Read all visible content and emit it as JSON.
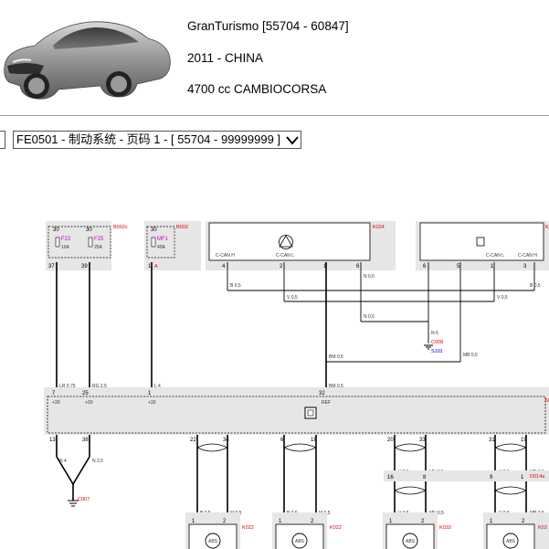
{
  "vehicle": {
    "model_line": "GranTurismo [55704 - 60847]",
    "year_market": "2011 - CHINA",
    "engine_gearbox": "4700 cc CAMBIOCORSA"
  },
  "selector": {
    "value": "FE0501 - 制动系统 - 页码 1 - [ 55704 - 99999999 ]"
  },
  "diagram": {
    "components": {
      "fusebox": "B002c",
      "fusebox2": "B003",
      "module_k024": "K024",
      "module_right": "K",
      "main_unit": "N",
      "ground1": "C008",
      "ground1_sub": "S101",
      "ground2": "C007",
      "connector": "D014a",
      "sensor1": "K022",
      "sensor2": "K022",
      "sensor3": "K033",
      "sensor4": "K03"
    },
    "fuses": [
      {
        "top": "30",
        "name": "F22",
        "rating": "10A"
      },
      {
        "top": "30",
        "name": "F25",
        "rating": "25A"
      },
      {
        "top": "30",
        "name": "MF1",
        "rating": "40A"
      }
    ],
    "pins_top": [
      "37",
      "39",
      "1",
      "4",
      "2",
      "1",
      "6",
      "6",
      "5",
      "1",
      "3"
    ],
    "pin_A": "A",
    "can_labels": [
      "C-CAN H",
      "C-CAN L",
      "C-CAN L",
      "C-CAN H"
    ],
    "wires": {
      "w_lr": "LR 0,75",
      "w_rg": "RG 2,5",
      "w_l4": "L 4",
      "w_bm1": "BM 0,5",
      "w_bm2": "BM 0,5",
      "w_mb": "MB 0,5",
      "w_b1": "B 0,5",
      "w_b2": "B 0,5",
      "w_v1": "V 0,5",
      "w_v2": "V 0,5",
      "w_n1": "N 0,5",
      "w_n2": "N 0,5",
      "w_n6": "N 6",
      "w_n4": "N 4",
      "w_n25": "N 2,5",
      "w_v05": "V 0,5",
      "w_mv": "MV 0,5",
      "w_v05b": "V 0,5",
      "w_mb05": "MB 0,5",
      "w_b05": "B 0,5",
      "w_m05": "M 0,5",
      "w_b05b": "B 0,5",
      "w_m05b": "M 0,5",
      "w_v05c": "V 0,5",
      "w_mv2": "MV 0,5",
      "w_v05d": "V 0,5",
      "w_mb2": "MB 0,5"
    },
    "main_pins_top": [
      "7",
      "25",
      "1",
      "32"
    ],
    "main_pin_labels": [
      "+30",
      "+30",
      "+30",
      "REF"
    ],
    "main_pins_bottom": [
      "13",
      "38",
      "22",
      "34",
      "6",
      "18",
      "20",
      "33",
      "31",
      "19"
    ],
    "conn_pins": [
      "16",
      "8",
      "9",
      "1"
    ],
    "sensor_pins": [
      "1",
      "2",
      "1",
      "2",
      "1",
      "2",
      "1",
      "2"
    ],
    "sensor_label": "ABS"
  },
  "colors": {
    "red_label": "#dd0000",
    "magenta_fuse": "#cc00cc",
    "component_fill": "#e6e6e6"
  }
}
